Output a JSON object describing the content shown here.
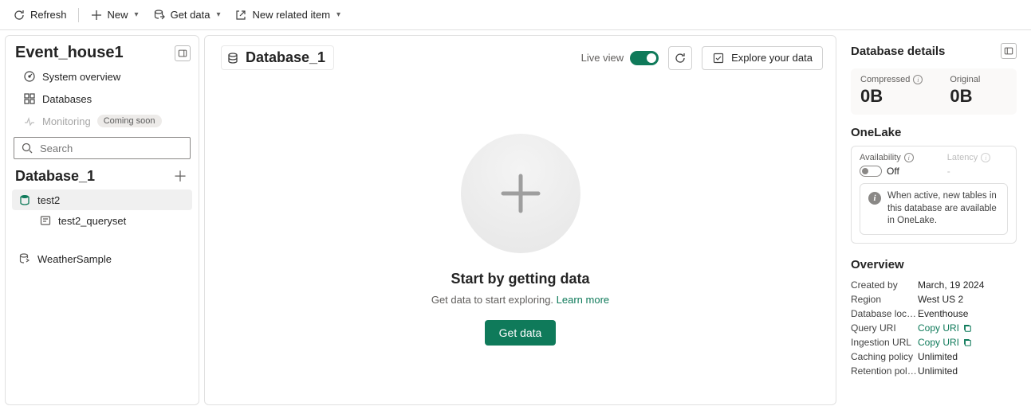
{
  "toolbar": {
    "refresh": "Refresh",
    "new": "New",
    "get_data": "Get data",
    "new_related": "New related item"
  },
  "eventhouse": {
    "title": "Event_house1",
    "nav": {
      "system_overview": "System overview",
      "databases": "Databases",
      "monitoring": "Monitoring",
      "monitoring_badge": "Coming soon"
    },
    "search_placeholder": "Search"
  },
  "database": {
    "title": "Database_1",
    "tree": {
      "item1": "test2",
      "item1_child": "test2_queryset",
      "item2": "WeatherSample"
    }
  },
  "main": {
    "crumb": "Database_1",
    "live_view_label": "Live view",
    "explore": "Explore your data",
    "empty_title": "Start by getting data",
    "empty_sub_prefix": "Get data to start exploring. ",
    "empty_sub_link": "Learn more",
    "get_data_btn": "Get data"
  },
  "details": {
    "title": "Database details",
    "compressed_label": "Compressed",
    "compressed_val": "0B",
    "original_label": "Original",
    "original_val": "0B",
    "onelake_title": "OneLake",
    "availability_label": "Availability",
    "availability_val": "Off",
    "latency_label": "Latency",
    "latency_val": "-",
    "onelake_info": "When active, new tables in this database are available in OneLake.",
    "overview_title": "Overview",
    "created_by_lbl": "Created by",
    "created_by_val": "March, 19 2024",
    "region_lbl": "Region",
    "region_val": "West US 2",
    "location_lbl": "Database locati…",
    "location_val": "Eventhouse",
    "query_uri_lbl": "Query URI",
    "copy_uri": "Copy URI",
    "ingestion_lbl": "Ingestion URL",
    "caching_lbl": "Caching policy",
    "caching_val": "Unlimited",
    "retention_lbl": "Retention policy",
    "retention_val": "Unlimited"
  }
}
